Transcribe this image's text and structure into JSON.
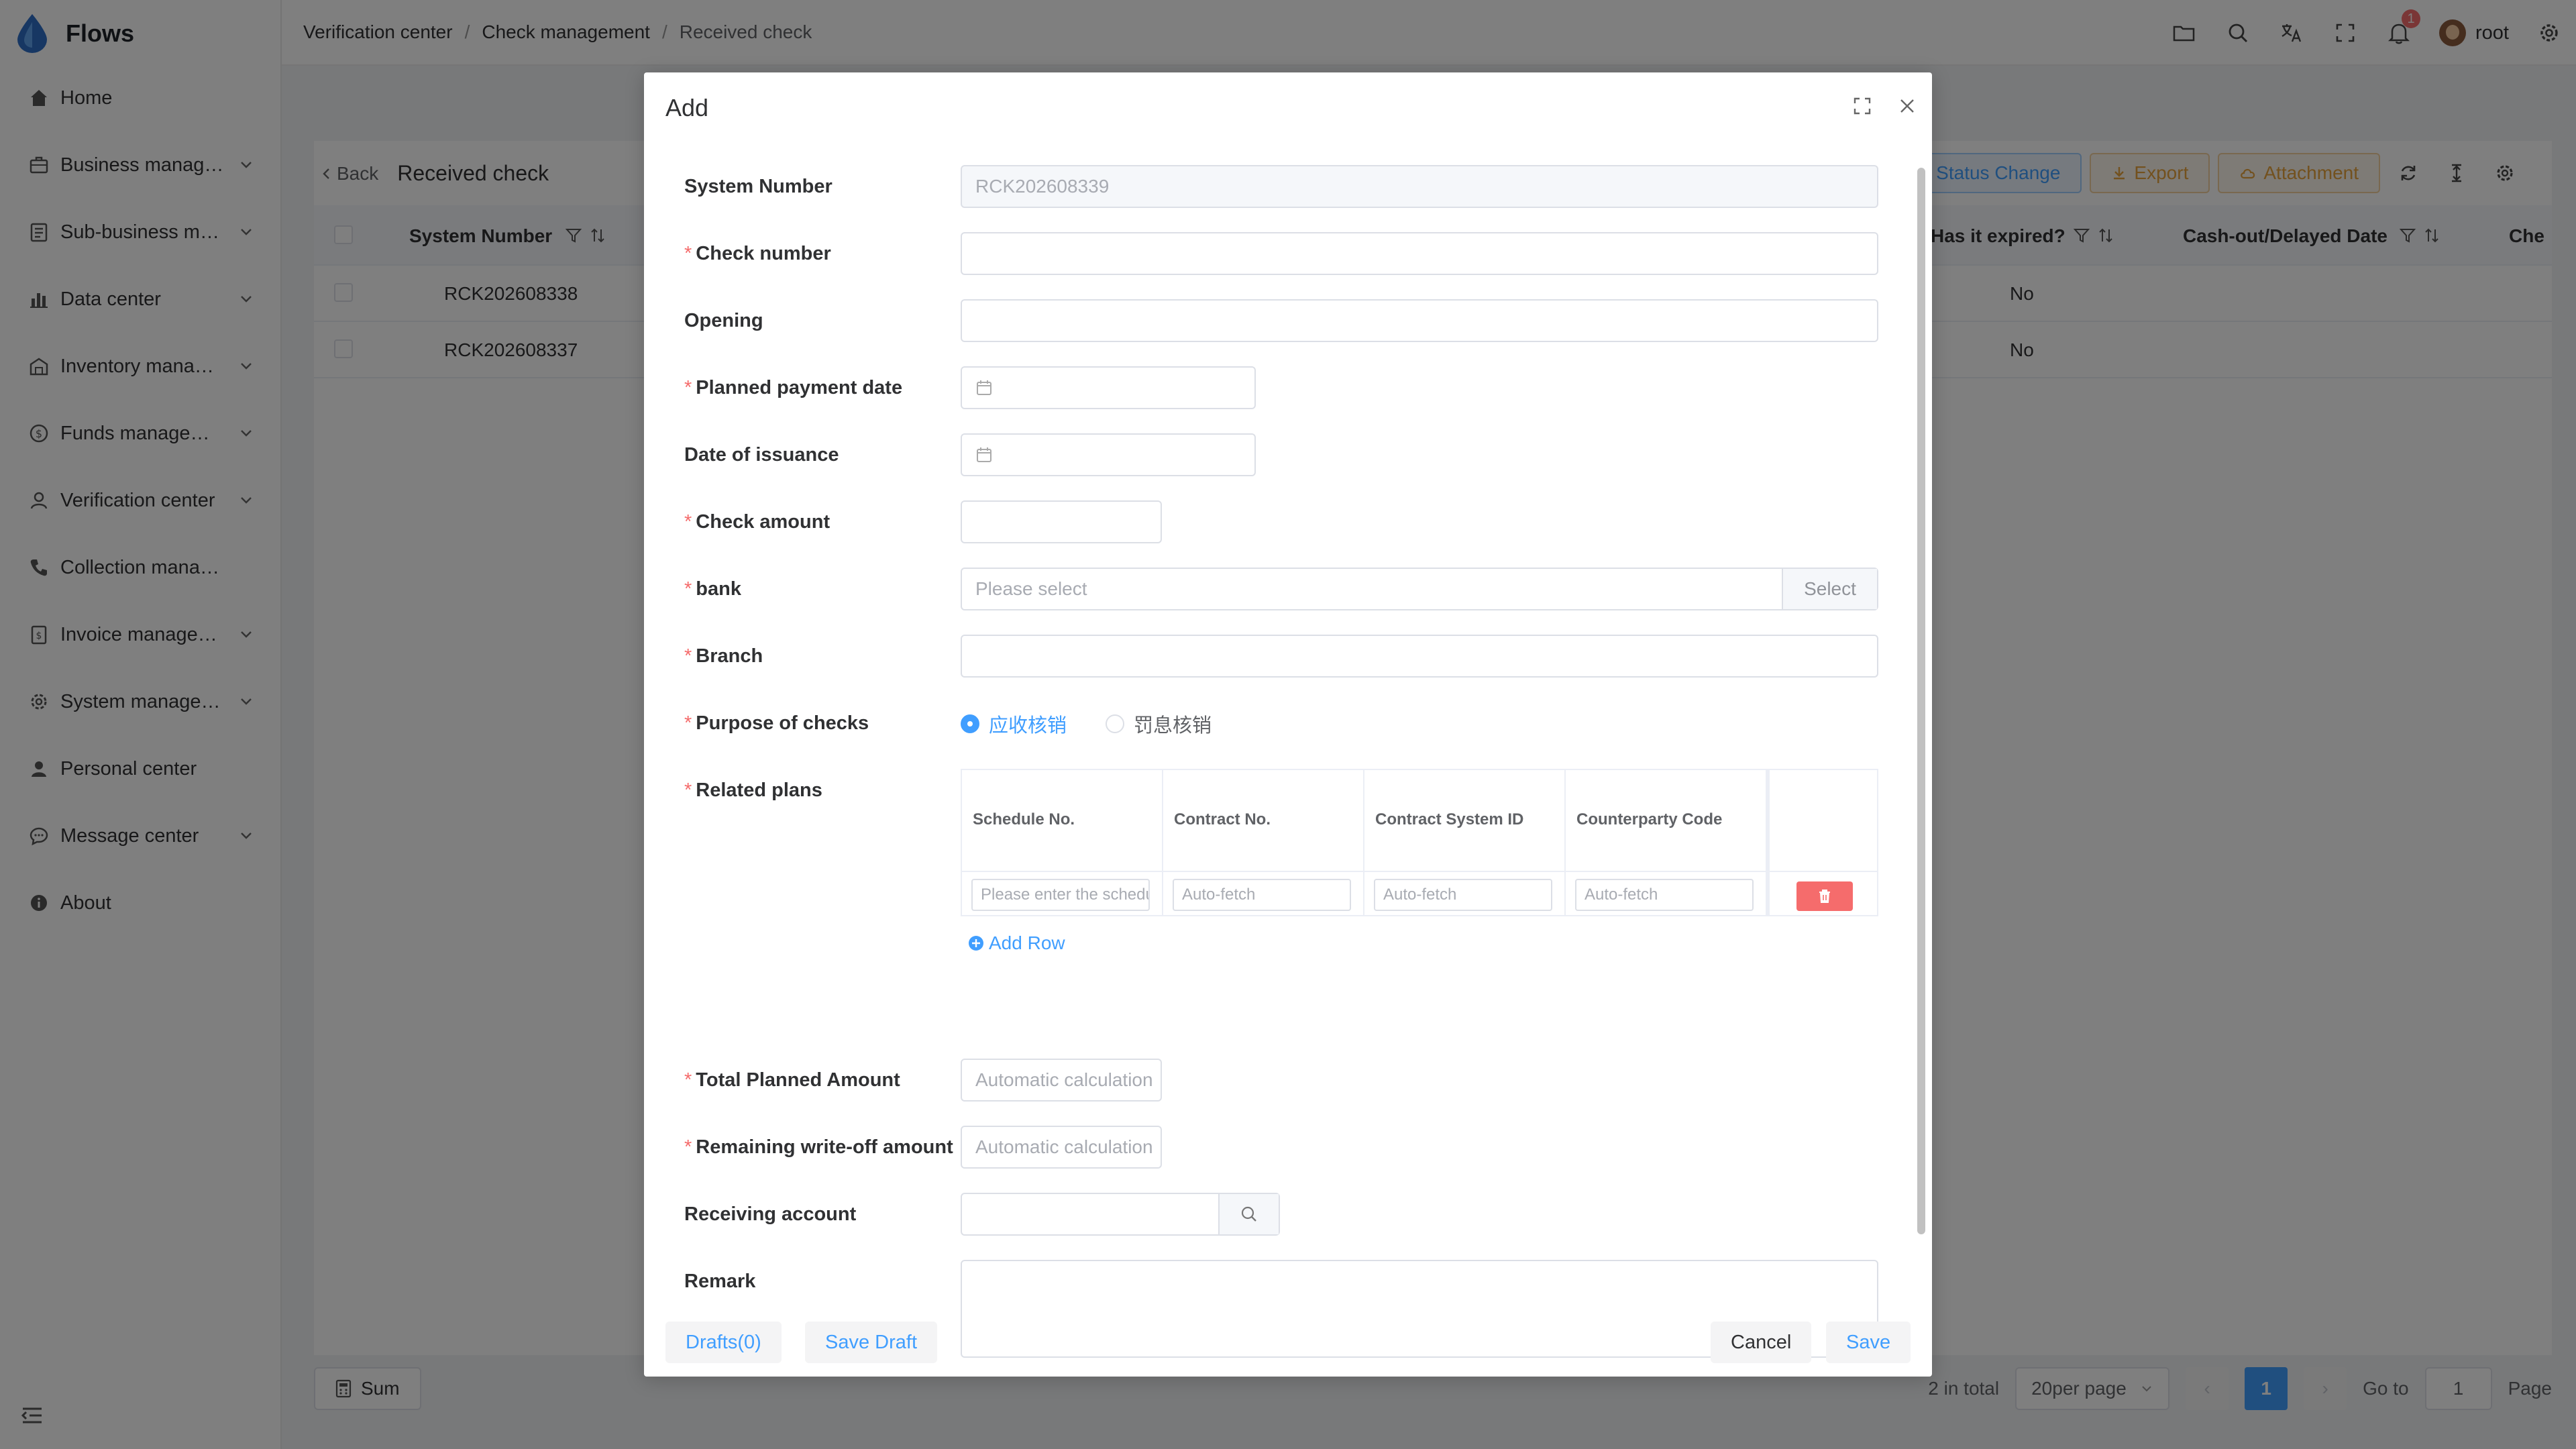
{
  "app": {
    "name": "Flows"
  },
  "sidebar": {
    "items": [
      {
        "label": "Home",
        "icon": "home-icon",
        "chevron": false
      },
      {
        "label": "Business management",
        "icon": "briefcase-icon",
        "chevron": true
      },
      {
        "label": "Sub-business management",
        "icon": "document-list-icon",
        "chevron": true
      },
      {
        "label": "Data center",
        "icon": "bar-chart-icon",
        "chevron": true
      },
      {
        "label": "Inventory management",
        "icon": "warehouse-icon",
        "chevron": true
      },
      {
        "label": "Funds management",
        "icon": "funds-icon",
        "chevron": true
      },
      {
        "label": "Verification center",
        "icon": "verification-icon",
        "chevron": true
      },
      {
        "label": "Collection management",
        "icon": "phone-icon",
        "chevron": false
      },
      {
        "label": "Invoice management",
        "icon": "invoice-icon",
        "chevron": true
      },
      {
        "label": "System management",
        "icon": "gear-icon",
        "chevron": true
      },
      {
        "label": "Personal center",
        "icon": "user-icon",
        "chevron": false
      },
      {
        "label": "Message center",
        "icon": "message-icon",
        "chevron": true
      },
      {
        "label": "About",
        "icon": "info-icon",
        "chevron": false
      }
    ]
  },
  "header": {
    "breadcrumb": [
      "Verification center",
      "Check management",
      "Received check"
    ],
    "notification_count": "1",
    "username": "root"
  },
  "page": {
    "back_label": "Back",
    "title": "Received check",
    "buttons": {
      "status_change": "Import Status Change",
      "export": "Export",
      "attachment": "Attachment"
    },
    "table": {
      "columns": [
        "System Number",
        "Has it expired?",
        "Cash-out/Delayed Date",
        "Che"
      ],
      "rows": [
        {
          "system_number": "RCK202608338",
          "expired": "No"
        },
        {
          "system_number": "RCK202608337",
          "expired": "No"
        }
      ]
    },
    "sum_label": "Sum",
    "pagination": {
      "total": "2 in total",
      "page_size": "20per page",
      "current": "1",
      "goto_label": "Go to",
      "goto_value": "1",
      "page_label": "Page"
    }
  },
  "dialog": {
    "title": "Add",
    "fields": {
      "system_number": {
        "label": "System Number",
        "value": "RCK202608339"
      },
      "check_number": {
        "label": "Check number",
        "value": ""
      },
      "opening": {
        "label": "Opening",
        "value": ""
      },
      "planned_payment_date": {
        "label": "Planned payment date",
        "value": ""
      },
      "date_of_issuance": {
        "label": "Date of issuance",
        "value": ""
      },
      "check_amount": {
        "label": "Check amount",
        "value": ""
      },
      "bank": {
        "label": "bank",
        "placeholder": "Please select",
        "append": "Select"
      },
      "branch": {
        "label": "Branch",
        "value": ""
      },
      "purpose": {
        "label": "Purpose of checks",
        "options": [
          "应收核销",
          "罚息核销"
        ],
        "selected": "应收核销"
      },
      "related_plans": {
        "label": "Related plans",
        "columns": [
          "Schedule No.",
          "Contract No.",
          "Contract System ID",
          "Counterparty Code"
        ],
        "row": {
          "schedule_placeholder": "Please enter the schedule no.",
          "contract_placeholder": "Auto-fetch",
          "system_id_placeholder": "Auto-fetch",
          "counterparty_placeholder": "Auto-fetch"
        },
        "add_row": "Add Row"
      },
      "total_planned_amount": {
        "label": "Total Planned Amount",
        "placeholder": "Automatic calculation"
      },
      "remaining_writeoff": {
        "label": "Remaining write-off amount",
        "placeholder": "Automatic calculation"
      },
      "receiving_account": {
        "label": "Receiving account",
        "value": ""
      },
      "remark": {
        "label": "Remark",
        "value": ""
      }
    },
    "footer": {
      "drafts": "Drafts(0)",
      "save_draft": "Save Draft",
      "cancel": "Cancel",
      "save": "Save"
    }
  },
  "colors": {
    "primary": "#409eff",
    "danger": "#f56c6c",
    "warning": "#e6a23c"
  }
}
